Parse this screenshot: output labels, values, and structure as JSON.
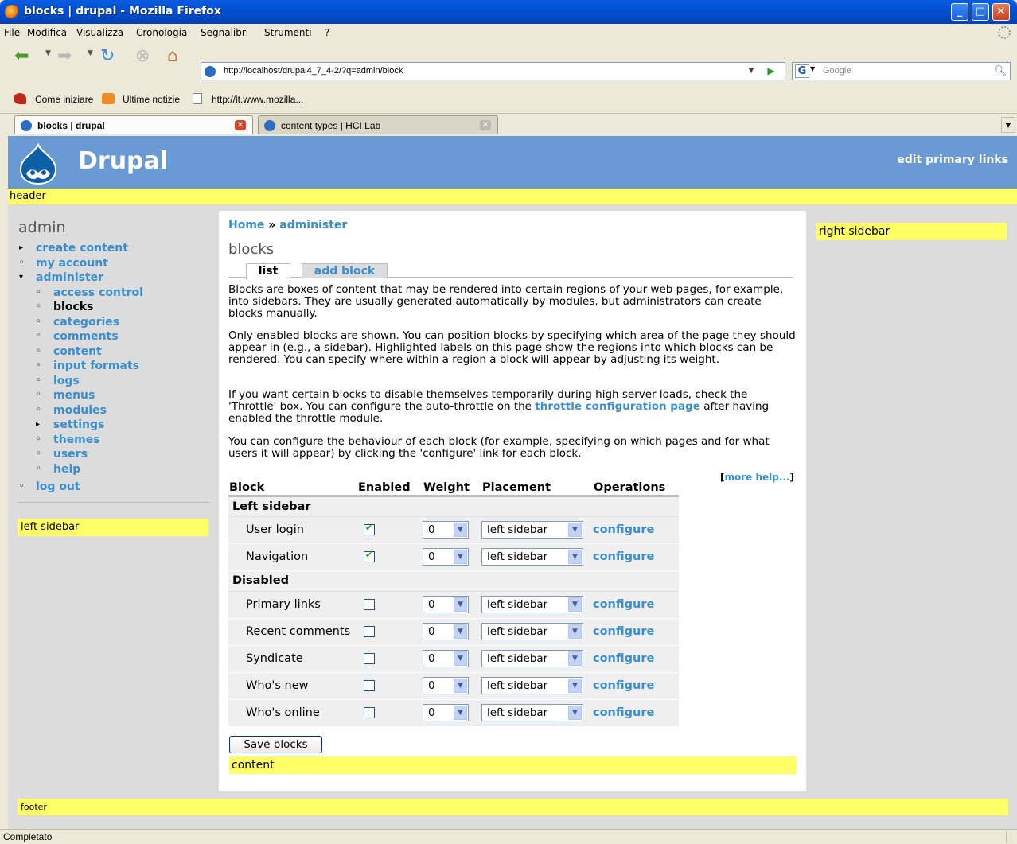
{
  "window": {
    "title": "blocks | drupal - Mozilla Firefox",
    "minimize": "_",
    "maximize": "□",
    "close": "✕"
  },
  "menubar": [
    "File",
    "Modifica",
    "Visualizza",
    "Cronologia",
    "Segnalibri",
    "Strumenti",
    "?"
  ],
  "toolbar": {
    "url": "http://localhost/drupal4_7_4-2/?q=admin/block",
    "search_placeholder": "Google",
    "search_engine": "G"
  },
  "bookmarks": [
    "Come iniziare",
    "Ultime notizie",
    "http://it.www.mozilla..."
  ],
  "tabs": [
    {
      "label": "blocks | drupal",
      "active": true
    },
    {
      "label": "content types | HCI Lab",
      "active": false
    }
  ],
  "site": {
    "name": "Drupal",
    "primary_links": "edit primary links",
    "regions": {
      "header": "header",
      "left": "left sidebar",
      "right": "right sidebar",
      "content": "content",
      "footer": "footer"
    }
  },
  "sidebar": {
    "title": "admin",
    "menu": [
      {
        "label": "create content",
        "level": 0,
        "bullet": "▸"
      },
      {
        "label": "my account",
        "level": 0,
        "bullet": "◦"
      },
      {
        "label": "administer",
        "level": 0,
        "bullet": "▾"
      },
      {
        "label": "access control",
        "level": 1,
        "bullet": "◦"
      },
      {
        "label": "blocks",
        "level": 1,
        "bullet": "◦",
        "current": true
      },
      {
        "label": "categories",
        "level": 1,
        "bullet": "◦"
      },
      {
        "label": "comments",
        "level": 1,
        "bullet": "◦"
      },
      {
        "label": "content",
        "level": 1,
        "bullet": "◦"
      },
      {
        "label": "input formats",
        "level": 1,
        "bullet": "◦"
      },
      {
        "label": "logs",
        "level": 1,
        "bullet": "◦"
      },
      {
        "label": "menus",
        "level": 1,
        "bullet": "◦"
      },
      {
        "label": "modules",
        "level": 1,
        "bullet": "◦"
      },
      {
        "label": "settings",
        "level": 1,
        "bullet": "▸"
      },
      {
        "label": "themes",
        "level": 1,
        "bullet": "◦"
      },
      {
        "label": "users",
        "level": 1,
        "bullet": "◦"
      },
      {
        "label": "help",
        "level": 1,
        "bullet": "◦"
      },
      {
        "label": "log out",
        "level": 0,
        "bullet": "◦"
      }
    ]
  },
  "main": {
    "breadcrumb": [
      "Home",
      "»",
      "administer"
    ],
    "title": "blocks",
    "tabs": [
      "list",
      "add block"
    ],
    "para1": "Blocks are boxes of content that may be rendered into certain regions of your web pages, for example, into sidebars. They are usually generated automatically by modules, but administrators can create blocks manually.",
    "para2": "Only enabled blocks are shown. You can position blocks by specifying which area of the page they should appear in (e.g., a sidebar). Highlighted labels on this page show the regions into which blocks can be rendered. You can specify where within a region a block will appear by adjusting its weight.",
    "para3_before": "If you want certain blocks to disable themselves temporarily during high server loads, check the 'Throttle' box. You can configure the auto-throttle on the",
    "para3_link": "throttle configuration page",
    "para3_after": "after having enabled the throttle module.",
    "para4": "You can configure the behaviour of each block (for example, specifying on which pages and for what users it will appear) by clicking the 'configure' link for each block.",
    "more_help_open": "[",
    "more_help": "more help...",
    "more_help_close": "]",
    "table": {
      "headers": [
        "Block",
        "Enabled",
        "Weight",
        "Placement",
        "Operations"
      ],
      "groups": [
        {
          "region": "Left sidebar",
          "rows": [
            {
              "name": "User login",
              "enabled": true,
              "weight": "0",
              "placement": "left sidebar",
              "op": "configure"
            },
            {
              "name": "Navigation",
              "enabled": true,
              "weight": "0",
              "placement": "left sidebar",
              "op": "configure"
            }
          ]
        },
        {
          "region": "Disabled",
          "rows": [
            {
              "name": "Primary links",
              "enabled": false,
              "weight": "0",
              "placement": "left sidebar",
              "op": "configure"
            },
            {
              "name": "Recent comments",
              "enabled": false,
              "weight": "0",
              "placement": "left sidebar",
              "op": "configure"
            },
            {
              "name": "Syndicate",
              "enabled": false,
              "weight": "0",
              "placement": "left sidebar",
              "op": "configure"
            },
            {
              "name": "Who's new",
              "enabled": false,
              "weight": "0",
              "placement": "left sidebar",
              "op": "configure"
            },
            {
              "name": "Who's online",
              "enabled": false,
              "weight": "0",
              "placement": "left sidebar",
              "op": "configure"
            }
          ]
        }
      ]
    },
    "save_label": "Save blocks"
  },
  "status": "Completato",
  "colors": {
    "link": "#3a8fcf",
    "header_bg": "#6a9ad3",
    "region_highlight": "#ffff66",
    "sidebar_bg": "#dcdcdc"
  }
}
